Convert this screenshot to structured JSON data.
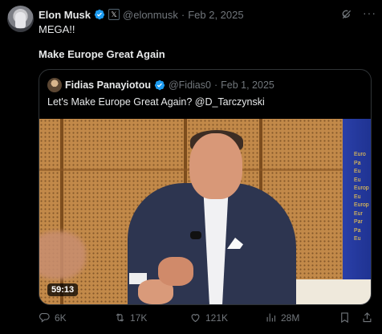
{
  "post": {
    "author_name": "Elon Musk",
    "handle": "@elonmusk",
    "separator": "·",
    "date": "Feb 2, 2025",
    "affiliate_badge": "𝕏",
    "line1": "MEGA!!",
    "line2": "Make Europe Great Again"
  },
  "quote": {
    "author_name": "Fidias Panayiotou",
    "handle": "@Fidias0",
    "separator": "·",
    "date": "Feb 1, 2025",
    "text_prefix": "Let's Make Europe Great Again? ",
    "mention": "@D_Tarczynski",
    "video_duration": "59:13",
    "banner_words": [
      "Euro",
      "Pa",
      "Eu",
      "Eu",
      "Europ",
      "Eu",
      "Europ",
      "Eur",
      "Par",
      "Pa",
      "Eu"
    ]
  },
  "actions": {
    "replies": "6K",
    "reposts": "17K",
    "likes": "121K",
    "views": "28M"
  },
  "colors": {
    "background": "#000000",
    "text": "#e7e9ea",
    "muted": "#71767b",
    "verified": "#1d9bf0",
    "border": "#2f3336"
  },
  "icons": [
    "verified-badge-icon",
    "x-affiliate-icon",
    "grok-icon",
    "more-icon",
    "reply-icon",
    "retweet-icon",
    "like-icon",
    "views-icon",
    "bookmark-icon",
    "share-icon"
  ]
}
